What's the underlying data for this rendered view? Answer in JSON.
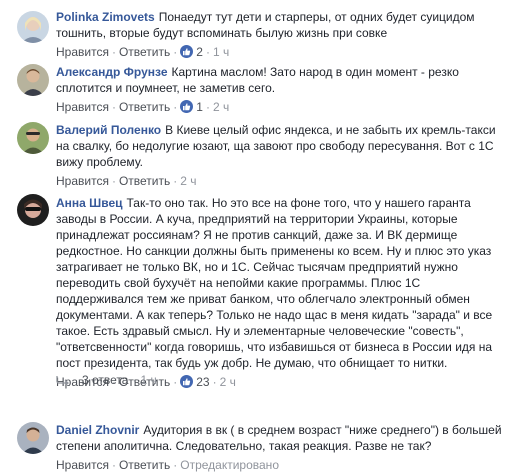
{
  "comments": [
    {
      "author": "Polinka Zimovets",
      "text": "Понаедут тут дети и старперы, от одних будет суицидом тошнить, вторые будут вспоминать былую жизнь при совке",
      "like": "Нравится",
      "reply": "Ответить",
      "likes": "2",
      "time": "1 ч"
    },
    {
      "author": "Александр Фрунзе",
      "text": "Картина маслом! Зато народ в один момент - резко сплотится и поумнеет, не заметив сего.",
      "like": "Нравится",
      "reply": "Ответить",
      "likes": "1",
      "time": "2 ч"
    },
    {
      "author": "Валерий Поленко",
      "text": "В Киеве целый офис яндекса, и не забыть их кремль-такси на свалку, бо недолугие юзают, ща завоют про свободу пересування. Вот с 1С вижу проблему.",
      "like": "Нравится",
      "reply": "Ответить",
      "time": "2 ч"
    },
    {
      "author": "Анна Швец",
      "text": "Так-то оно так. Но это все на фоне того, что у нашего гаранта заводы в России. А куча, предприятий на территории Украины, которые принадлежат россиянам? Я не против санкций, даже за. И ВК дермище редкостное. Но санкции должны быть применены ко всем. Ну и плюс это указ затрагивает не только ВК, но и 1С. Сейчас тысячам предприятий нужно переводить свой бухучёт на непойми какие программы. Плюс 1С поддерживался тем же приват банком, что облегчало электронный обмен документами. А как теперь? Только не надо щас в меня кидать \"зарада\" и все такое. Есть здравый смысл. Ну и элементарные человеческие \"совесть\", \"ответсвенности\" когда говоришь, что избавишься от бизнеса в России идя на пост президента, так будь уж добр. Не думаю, что обнищает то нитки.",
      "like": "Нравится",
      "reply": "Ответить",
      "likes": "23",
      "time": "2 ч"
    },
    {
      "author": "Daniel Zhovnir",
      "text": "Аудитория в вк ( в среднем возраст \"ниже среднего\") в большей степени аполитична. Следовательно, такая реакция. Разве не так?",
      "like": "Нравится",
      "reply": "Ответить",
      "edited": "Отредактировано"
    }
  ],
  "replies_toggle": {
    "label": "3 ответа",
    "time": "1 ч"
  },
  "colors": {
    "author": "#365899",
    "action": "#4b4f56",
    "muted": "#90949c",
    "like_badge": "#4267b2"
  }
}
